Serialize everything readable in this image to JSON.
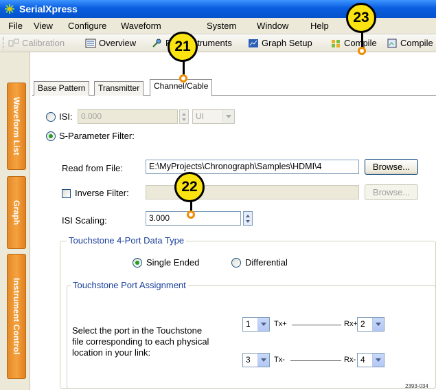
{
  "window": {
    "title": "SerialXpress",
    "app_icon": "serialxpress-app-icon"
  },
  "menu": [
    "File",
    "View",
    "Configure",
    "Waveform",
    "System",
    "Window",
    "Help"
  ],
  "toolbar": {
    "calibration": "Calibration",
    "overview": "Overview",
    "find_instruments": "Find Instruments",
    "graph_setup": "Graph Setup",
    "compile": "Compile",
    "compile2": "Compile"
  },
  "sidebar": {
    "waveform_list": "Waveform List",
    "graph": "Graph",
    "instrument_control": "Instrument Control"
  },
  "tabs": [
    "Base Pattern",
    "Transmitter",
    "Channel/Cable"
  ],
  "isi": {
    "label": "ISI:",
    "value": "0.000",
    "unit": "UI"
  },
  "sparam": {
    "label": "S-Parameter Filter:"
  },
  "read_file": {
    "label": "Read from File:",
    "value": "E:\\MyProjects\\Chronograph\\Samples\\HDMI\\4",
    "browse": "Browse..."
  },
  "inverse": {
    "label": "Inverse Filter:",
    "value": "",
    "browse": "Browse..."
  },
  "isi_scaling": {
    "label": "ISI Scaling:",
    "value": "3.000"
  },
  "data_type": {
    "title": "Touchstone 4-Port Data Type",
    "single": "Single Ended",
    "differential": "Differential"
  },
  "port_assign": {
    "title": "Touchstone Port Assignment",
    "description_line1": "Select the port in the Touchstone",
    "description_line2": "file corresponding to each physical",
    "description_line3": "location in your link:",
    "tx_plus_port": "1",
    "tx_plus": "Tx+",
    "rx_plus": "Rx+",
    "rx_plus_port": "2",
    "tx_minus_port": "3",
    "tx_minus": "Tx-",
    "rx_minus": "Rx-",
    "rx_minus_port": "4"
  },
  "callouts": {
    "c21": "21",
    "c22": "22",
    "c23": "23"
  },
  "figure_id": "2393-034",
  "colors": {
    "title_bar": "#0a5ee0",
    "vtab": "#f39a32",
    "callout": "#fbe312",
    "callout_dot": "#f28c00",
    "group_title": "#1a3f9b",
    "radio_selected": "#21a121"
  }
}
